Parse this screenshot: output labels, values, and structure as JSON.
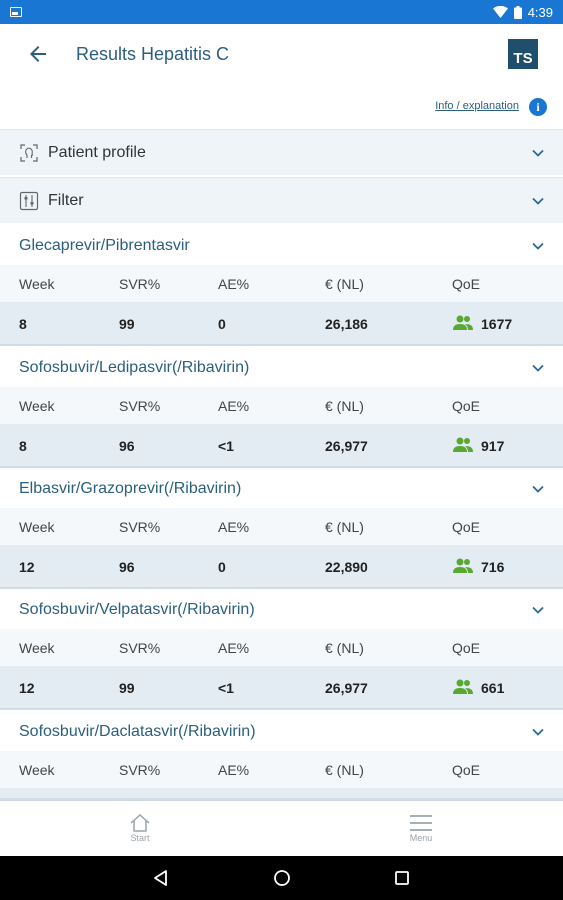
{
  "status_bar": {
    "time": "4:39"
  },
  "header": {
    "title": "Results Hepatitis C",
    "logo_text": "TS",
    "back_icon": "arrow-back-icon"
  },
  "info": {
    "link_text": "Info / explanation",
    "icon_text": "i"
  },
  "sections": [
    {
      "label": "Patient profile",
      "icon": "head-profile-icon"
    },
    {
      "label": "Filter",
      "icon": "filter-sliders-icon"
    }
  ],
  "columns": [
    "Week",
    "SVR%",
    "AE%",
    "€ (NL)",
    "QoE"
  ],
  "drugs": [
    {
      "name": "Glecaprevir/Pibrentasvir",
      "values": [
        "8",
        "99",
        "0",
        "26,186",
        "1677"
      ]
    },
    {
      "name": "Sofosbuvir/Ledipasvir(/Ribavirin)",
      "values": [
        "8",
        "96",
        "<1",
        "26,977",
        "917"
      ]
    },
    {
      "name": "Elbasvir/Grazoprevir(/Ribavirin)",
      "values": [
        "12",
        "96",
        "0",
        "22,890",
        "716"
      ]
    },
    {
      "name": "Sofosbuvir/Velpatasvir(/Ribavirin)",
      "values": [
        "12",
        "99",
        "<1",
        "26,977",
        "661"
      ]
    },
    {
      "name": "Sofosbuvir/Daclatasvir(/Ribavirin)",
      "values": []
    }
  ],
  "bottom_nav": {
    "start": "Start",
    "menu": "Menu"
  },
  "colors": {
    "status_bar": "#1976d2",
    "accent_text": "#2b5f7f",
    "qoe_icon": "#5aa832"
  }
}
